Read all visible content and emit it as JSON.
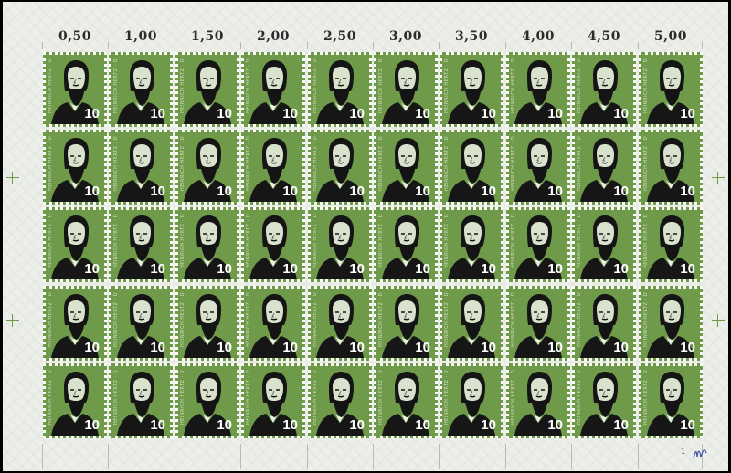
{
  "sheet": {
    "counters": [
      "0,50",
      "1,00",
      "1,50",
      "2,00",
      "2,50",
      "3,00",
      "3,50",
      "4,00",
      "4,50",
      "5,00"
    ],
    "rows": 5,
    "columns": 10,
    "stamp": {
      "denomination": "10",
      "side_text": "HEINRICH HERTZ · DEUTSCHE BUNDESPOST",
      "portrait": "bearded-man-portrait",
      "background_color": "#6f9a49",
      "perforation_color": "#fbfbf8"
    },
    "sheet_number": "1",
    "margin_color": "#eceee9"
  }
}
